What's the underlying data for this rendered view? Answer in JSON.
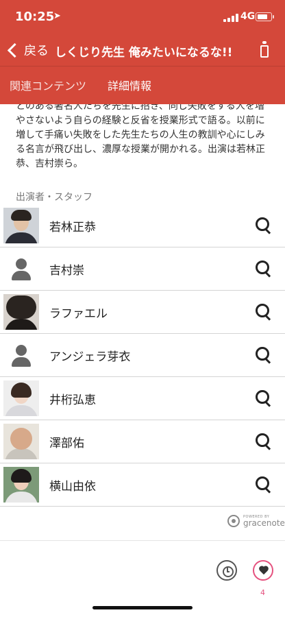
{
  "status_bar": {
    "time": "10:25",
    "network": "4G",
    "battery_level": 0.8
  },
  "nav": {
    "back_label": "戻る",
    "title": "しくじり先生 俺みたいになるな!!"
  },
  "tabs": [
    {
      "label": "関連コンテンツ",
      "selected": false
    },
    {
      "label": "詳細情報",
      "selected": true
    }
  ],
  "description": "とのある著名人たちを先生に招き、同じ失敗をする人を増やさないよう自らの経験と反省を授業形式で語る。以前に増して手痛い失敗をした先生たちの人生の教訓や心にしみる名言が飛び出し、濃厚な授業が開かれる。出演は若林正恭、吉村崇ら。",
  "cast_section": {
    "label": "出演者・スタッフ",
    "members": [
      {
        "name": "若林正恭",
        "thumb": "photo"
      },
      {
        "name": "吉村崇",
        "thumb": "placeholder"
      },
      {
        "name": "ラファエル",
        "thumb": "photo"
      },
      {
        "name": "アンジェラ芽衣",
        "thumb": "placeholder"
      },
      {
        "name": "井桁弘恵",
        "thumb": "photo"
      },
      {
        "name": "澤部佑",
        "thumb": "photo"
      },
      {
        "name": "横山由依",
        "thumb": "photo"
      }
    ]
  },
  "credit": {
    "small": "POWERED BY",
    "brand": "gracenote"
  },
  "favorites": {
    "count": "4"
  },
  "colors": {
    "brand": "#d4483a",
    "favorite": "#e5517e"
  },
  "icons": [
    "back-chevron-icon",
    "remote-icon",
    "search-icon",
    "person-placeholder-icon",
    "history-clock-icon",
    "heart-icon",
    "gracenote-logo-icon"
  ]
}
